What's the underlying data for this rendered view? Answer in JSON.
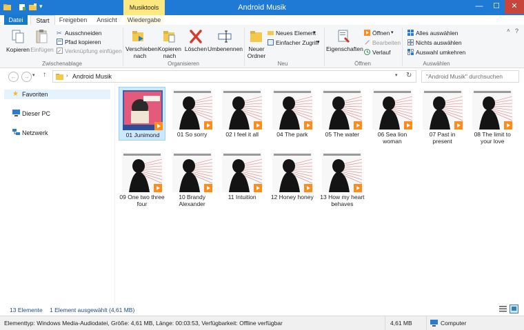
{
  "window": {
    "title": "Android Musik",
    "context_tab_group": "Musiktools",
    "controls": {
      "minimize": "—",
      "maximize": "☐",
      "close": "✕"
    }
  },
  "tabs": [
    {
      "label": "Datei"
    },
    {
      "label": "Start"
    },
    {
      "label": "Freigeben"
    },
    {
      "label": "Ansicht"
    },
    {
      "label": "Wiedergabe"
    }
  ],
  "ribbon": {
    "clipboard": {
      "label": "Zwischenablage",
      "copy": "Kopieren",
      "paste": "Einfügen",
      "cut": "Ausschneiden",
      "copy_path": "Pfad kopieren",
      "paste_shortcut": "Verknüpfung einfügen"
    },
    "organize": {
      "label": "Organisieren",
      "move_to_1": "Verschieben",
      "move_to_2": "nach",
      "copy_to_1": "Kopieren",
      "copy_to_2": "nach",
      "delete": "Löschen",
      "rename": "Umbenennen"
    },
    "new": {
      "label": "Neu",
      "new_folder_1": "Neuer",
      "new_folder_2": "Ordner",
      "new_item": "Neues Element",
      "easy_access": "Einfacher Zugriff"
    },
    "open": {
      "label": "Öffnen",
      "properties": "Eigenschaften",
      "open": "Öffnen",
      "edit": "Bearbeiten",
      "history": "Verlauf"
    },
    "select": {
      "label": "Auswählen",
      "select_all": "Alles auswählen",
      "select_none": "Nichts auswählen",
      "invert": "Auswahl umkehren"
    }
  },
  "address": {
    "path": "Android Musik",
    "search_placeholder": "\"Android Musik\" durchsuchen"
  },
  "nav": [
    {
      "label": "Favoriten"
    },
    {
      "label": "Dieser PC"
    },
    {
      "label": "Netzwerk"
    }
  ],
  "items": [
    {
      "name": "01 Junimond",
      "art": "a"
    },
    {
      "name": "01 So sorry",
      "art": "b"
    },
    {
      "name": "02 I feel it all",
      "art": "b"
    },
    {
      "name": "04 The park",
      "art": "b"
    },
    {
      "name": "05 The water",
      "art": "b"
    },
    {
      "name": "06 Sea lion woman",
      "art": "b"
    },
    {
      "name": "07 Past in present",
      "art": "b"
    },
    {
      "name": "08 The limit to your love",
      "art": "b"
    },
    {
      "name": "09 One two three four",
      "art": "b"
    },
    {
      "name": "10 Brandy Alexander",
      "art": "b"
    },
    {
      "name": "11 Intuition",
      "art": "b"
    },
    {
      "name": "12 Honey honey",
      "art": "b"
    },
    {
      "name": "13 How my heart behaves",
      "art": "b"
    }
  ],
  "status": {
    "count": "13 Elemente",
    "selected": "1 Element ausgewählt (4,61 MB)",
    "details": "Elementtyp: Windows Media-Audiodatei, Größe: 4,61 MB, Länge: 00:03:53, Verfügbarkeit: Offline verfügbar",
    "size": "4,61 MB",
    "location": "Computer"
  },
  "colors": {
    "titlebar": "#1f7ad6",
    "context_tab": "#fde880",
    "selection": "#cce8ff",
    "media_badge": "#ff8c1a"
  }
}
